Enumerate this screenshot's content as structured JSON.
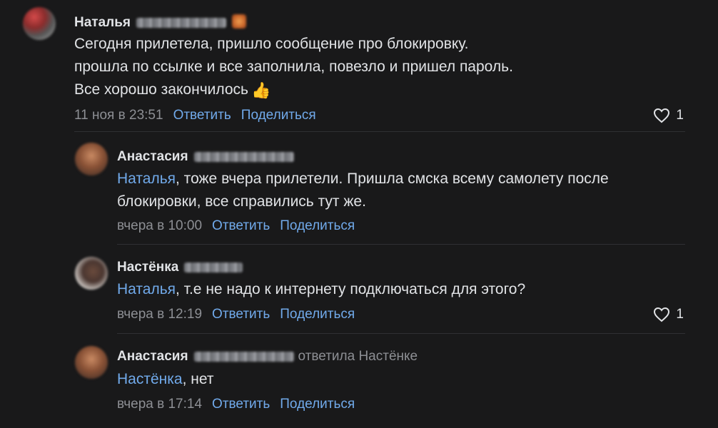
{
  "comments": [
    {
      "author": "Наталья",
      "lines": [
        "Сегодня прилетела, пришло сообщение про блокировку.",
        "прошла по ссылке и все заполнила, повезло и пришел пароль.",
        "Все хорошо закончилось"
      ],
      "emoji": "👍",
      "date": "11 ноя в 23:51",
      "reply_label": "Ответить",
      "share_label": "Поделиться",
      "likes": "1"
    },
    {
      "author": "Анастасия",
      "mention": "Наталья",
      "line1_rest": ", тоже вчера прилетели. Пришла смска всему самолету после",
      "line2": "блокировки, все справились тут же.",
      "date": "вчера в 10:00",
      "reply_label": "Ответить",
      "share_label": "Поделиться"
    },
    {
      "author": "Настёнка",
      "mention": "Наталья",
      "line1_rest": ", т.е не надо к интернету подключаться для этого?",
      "date": "вчера в 12:19",
      "reply_label": "Ответить",
      "share_label": "Поделиться",
      "likes": "1"
    },
    {
      "author": "Анастасия",
      "replied_to": "ответила Настёнке",
      "mention": "Настёнка",
      "line1_rest": ", нет",
      "date": "вчера в 17:14",
      "reply_label": "Ответить",
      "share_label": "Поделиться"
    }
  ],
  "colors": {
    "background": "#19191a",
    "text": "#e1e3e6",
    "link": "#71aaeb",
    "muted": "#8d8f94",
    "divider": "#2f3033"
  }
}
